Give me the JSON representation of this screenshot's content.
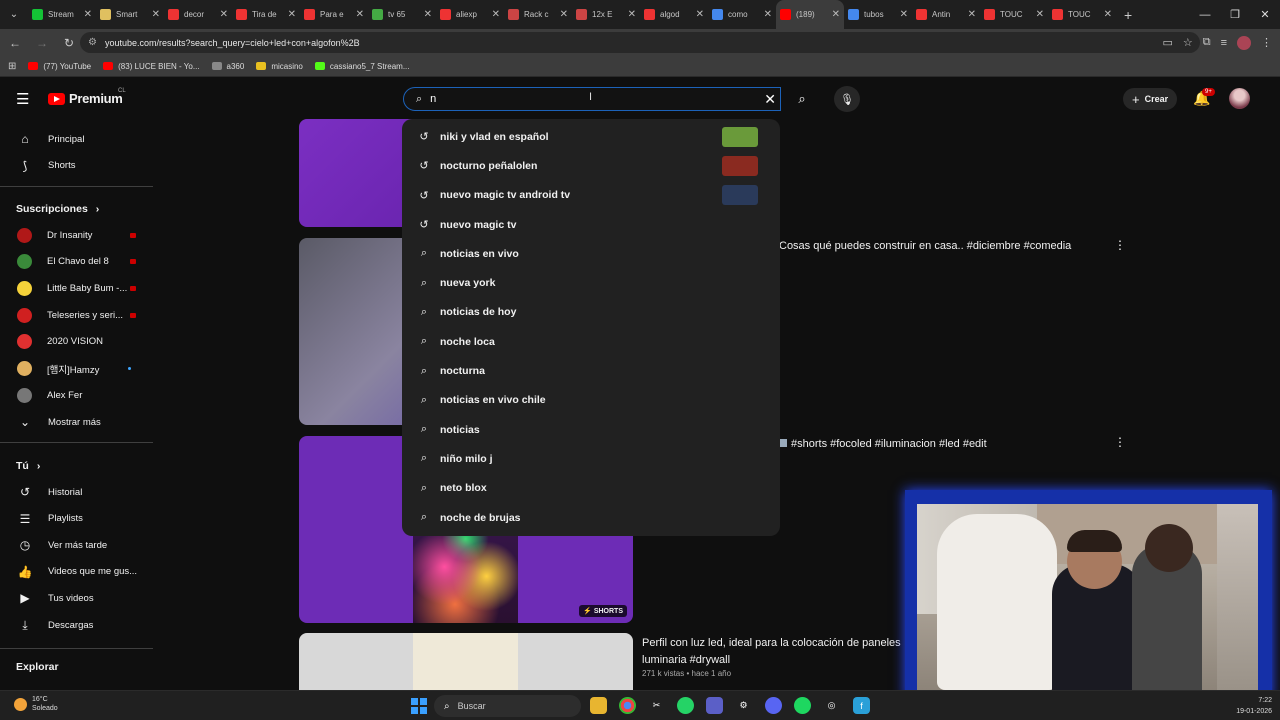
{
  "browser": {
    "tabs": [
      {
        "label": "Stream",
        "color": "#14c236"
      },
      {
        "label": "Smart",
        "color": "#e0c060"
      },
      {
        "label": "decor",
        "color": "#e33"
      },
      {
        "label": "Tira de",
        "color": "#e33"
      },
      {
        "label": "Para e",
        "color": "#e33"
      },
      {
        "label": "tv 65",
        "color": "#4a4"
      },
      {
        "label": "aliexp",
        "color": "#e33"
      },
      {
        "label": "Rack c",
        "color": "#c44"
      },
      {
        "label": "12x E",
        "color": "#c44"
      },
      {
        "label": "algod",
        "color": "#e33"
      },
      {
        "label": "como",
        "color": "#4488ee"
      },
      {
        "label": "(189)",
        "color": "#ff0000"
      },
      {
        "label": "tubos",
        "color": "#4488ee"
      },
      {
        "label": "Antin",
        "color": "#e33"
      },
      {
        "label": "TOUC",
        "color": "#e33"
      },
      {
        "label": "TOUC",
        "color": "#e33"
      }
    ],
    "active_tab_index": 11,
    "url": "youtube.com/results?search_query=cielo+led+con+algofon%2B",
    "bookmarks": [
      {
        "label": "(77) YouTube",
        "color": "#ff0000"
      },
      {
        "label": "(83) LUCE BIEN - Yo...",
        "color": "#ff0000"
      },
      {
        "label": "a360",
        "color": "#888"
      },
      {
        "label": "micasino",
        "color": "#e8c020"
      },
      {
        "label": "cassiano5_7 Stream...",
        "color": "#53fc18"
      }
    ]
  },
  "youtube": {
    "logo_text": "Premium",
    "country": "CL",
    "search_value": "n",
    "create_label": "Crear",
    "notif_badge": "9+",
    "sidebar": {
      "top": [
        {
          "label": "Principal",
          "icon": "home-icon"
        },
        {
          "label": "Shorts",
          "icon": "shorts-icon"
        }
      ],
      "subs_title": "Suscripciones",
      "subs": [
        {
          "label": "Dr Insanity",
          "color": "#b01818",
          "status": "live"
        },
        {
          "label": "El Chavo del 8",
          "color": "#3a8a3a",
          "status": "live"
        },
        {
          "label": "Little Baby Bum -...",
          "color": "#f5d23a",
          "status": "live"
        },
        {
          "label": "Teleseries y seri...",
          "color": "#d02020",
          "status": "live"
        },
        {
          "label": "2020 VISION",
          "color": "#e03030",
          "status": ""
        },
        {
          "label": "[햄지]Hamzy",
          "color": "#e0b060",
          "status": "dot"
        },
        {
          "label": "Alex Fer",
          "color": "#777",
          "status": ""
        }
      ],
      "more_label": "Mostrar más",
      "you_title": "Tú",
      "you": [
        {
          "label": "Historial",
          "icon": "history-icon"
        },
        {
          "label": "Playlists",
          "icon": "playlists-icon"
        },
        {
          "label": "Ver más tarde",
          "icon": "watch-later-icon"
        },
        {
          "label": "Videos que me gus...",
          "icon": "like-icon"
        },
        {
          "label": "Tus videos",
          "icon": "your-videos-icon"
        },
        {
          "label": "Descargas",
          "icon": "download-icon"
        }
      ],
      "explore_title": "Explorar"
    },
    "suggestions": [
      {
        "text": "niki y vlad en español",
        "type": "history",
        "thumb": "#6a9a3a"
      },
      {
        "text": "nocturno peñalolen",
        "type": "history",
        "thumb": "#8a2a20"
      },
      {
        "text": "nuevo magic tv android tv",
        "type": "history",
        "thumb": "#2a3a5a"
      },
      {
        "text": "nuevo magic tv",
        "type": "history",
        "thumb": ""
      },
      {
        "text": "noticias en vivo",
        "type": "search",
        "thumb": ""
      },
      {
        "text": "nueva york",
        "type": "search",
        "thumb": ""
      },
      {
        "text": "noticias de hoy",
        "type": "search",
        "thumb": ""
      },
      {
        "text": "noche loca",
        "type": "search",
        "thumb": ""
      },
      {
        "text": "nocturna",
        "type": "search",
        "thumb": ""
      },
      {
        "text": "noticias en vivo chile",
        "type": "search",
        "thumb": ""
      },
      {
        "text": "noticias",
        "type": "search",
        "thumb": ""
      },
      {
        "text": "niño milo j",
        "type": "search",
        "thumb": ""
      },
      {
        "text": "neto blox",
        "type": "search",
        "thumb": ""
      },
      {
        "text": "noche de brujas",
        "type": "search",
        "thumb": ""
      }
    ],
    "results": [
      {
        "title": "Cosas qué puedes construir en casa.. #diciembre #comedia",
        "meta": ""
      },
      {
        "title": "#shorts #focoled #iluminacion #led #edit",
        "meta": "",
        "badge": "SHORTS"
      },
      {
        "title_line1": "Perfil con luz led, ideal para la colocación de paneles",
        "title_line2": "luminaria #drywall",
        "meta": "271 k vistas • hace 1 año"
      }
    ]
  },
  "taskbar": {
    "temp": "16°C",
    "weather": "Soleado",
    "search_label": "Buscar",
    "time": "7:22",
    "date": "19-01-2026"
  }
}
